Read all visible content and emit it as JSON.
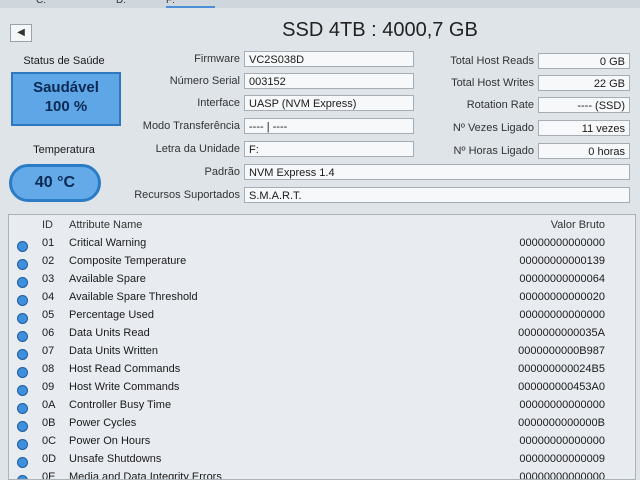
{
  "tabs": [
    "C:",
    "D:",
    "F:"
  ],
  "nav": {
    "prev_icon": "◀"
  },
  "title": "SSD 4TB : 4000,7 GB",
  "health": {
    "label": "Status de Saúde",
    "status": "Saudável",
    "percent": "100 %"
  },
  "temperature": {
    "label": "Temperatura",
    "value": "40 °C"
  },
  "info": {
    "firmware": {
      "label": "Firmware",
      "value": "VC2S038D"
    },
    "serial": {
      "label": "Número Serial",
      "value": "003152"
    },
    "interface": {
      "label": "Interface",
      "value": "UASP (NVM Express)"
    },
    "transfer": {
      "label": "Modo Transferência",
      "value": "---- | ----"
    },
    "drive_letter": {
      "label": "Letra da Unidade",
      "value": "F:"
    },
    "standard": {
      "label": "Padrão",
      "value": "NVM Express 1.4"
    },
    "features": {
      "label": "Recursos Suportados",
      "value": "S.M.A.R.T."
    }
  },
  "stats": {
    "host_reads": {
      "label": "Total Host Reads",
      "value": "0 GB"
    },
    "host_writes": {
      "label": "Total Host Writes",
      "value": "22 GB"
    },
    "rotation": {
      "label": "Rotation Rate",
      "value": "---- (SSD)"
    },
    "power_count": {
      "label": "Nº Vezes Ligado",
      "value": "11 vezes"
    },
    "power_hours": {
      "label": "Nº Horas Ligado",
      "value": "0 horas"
    }
  },
  "table": {
    "headers": {
      "id": "ID",
      "name": "Attribute Name",
      "raw": "Valor Bruto"
    },
    "rows": [
      {
        "id": "01",
        "name": "Critical Warning",
        "raw": "00000000000000"
      },
      {
        "id": "02",
        "name": "Composite Temperature",
        "raw": "00000000000139"
      },
      {
        "id": "03",
        "name": "Available Spare",
        "raw": "00000000000064"
      },
      {
        "id": "04",
        "name": "Available Spare Threshold",
        "raw": "00000000000020"
      },
      {
        "id": "05",
        "name": "Percentage Used",
        "raw": "00000000000000"
      },
      {
        "id": "06",
        "name": "Data Units Read",
        "raw": "0000000000035A"
      },
      {
        "id": "07",
        "name": "Data Units Written",
        "raw": "0000000000B987"
      },
      {
        "id": "08",
        "name": "Host Read Commands",
        "raw": "000000000024B5"
      },
      {
        "id": "09",
        "name": "Host Write Commands",
        "raw": "000000000453A0"
      },
      {
        "id": "0A",
        "name": "Controller Busy Time",
        "raw": "00000000000000"
      },
      {
        "id": "0B",
        "name": "Power Cycles",
        "raw": "0000000000000B"
      },
      {
        "id": "0C",
        "name": "Power On Hours",
        "raw": "00000000000000"
      },
      {
        "id": "0D",
        "name": "Unsafe Shutdowns",
        "raw": "00000000000009"
      },
      {
        "id": "0E",
        "name": "Media and Data Integrity Errors",
        "raw": "00000000000000"
      }
    ]
  }
}
